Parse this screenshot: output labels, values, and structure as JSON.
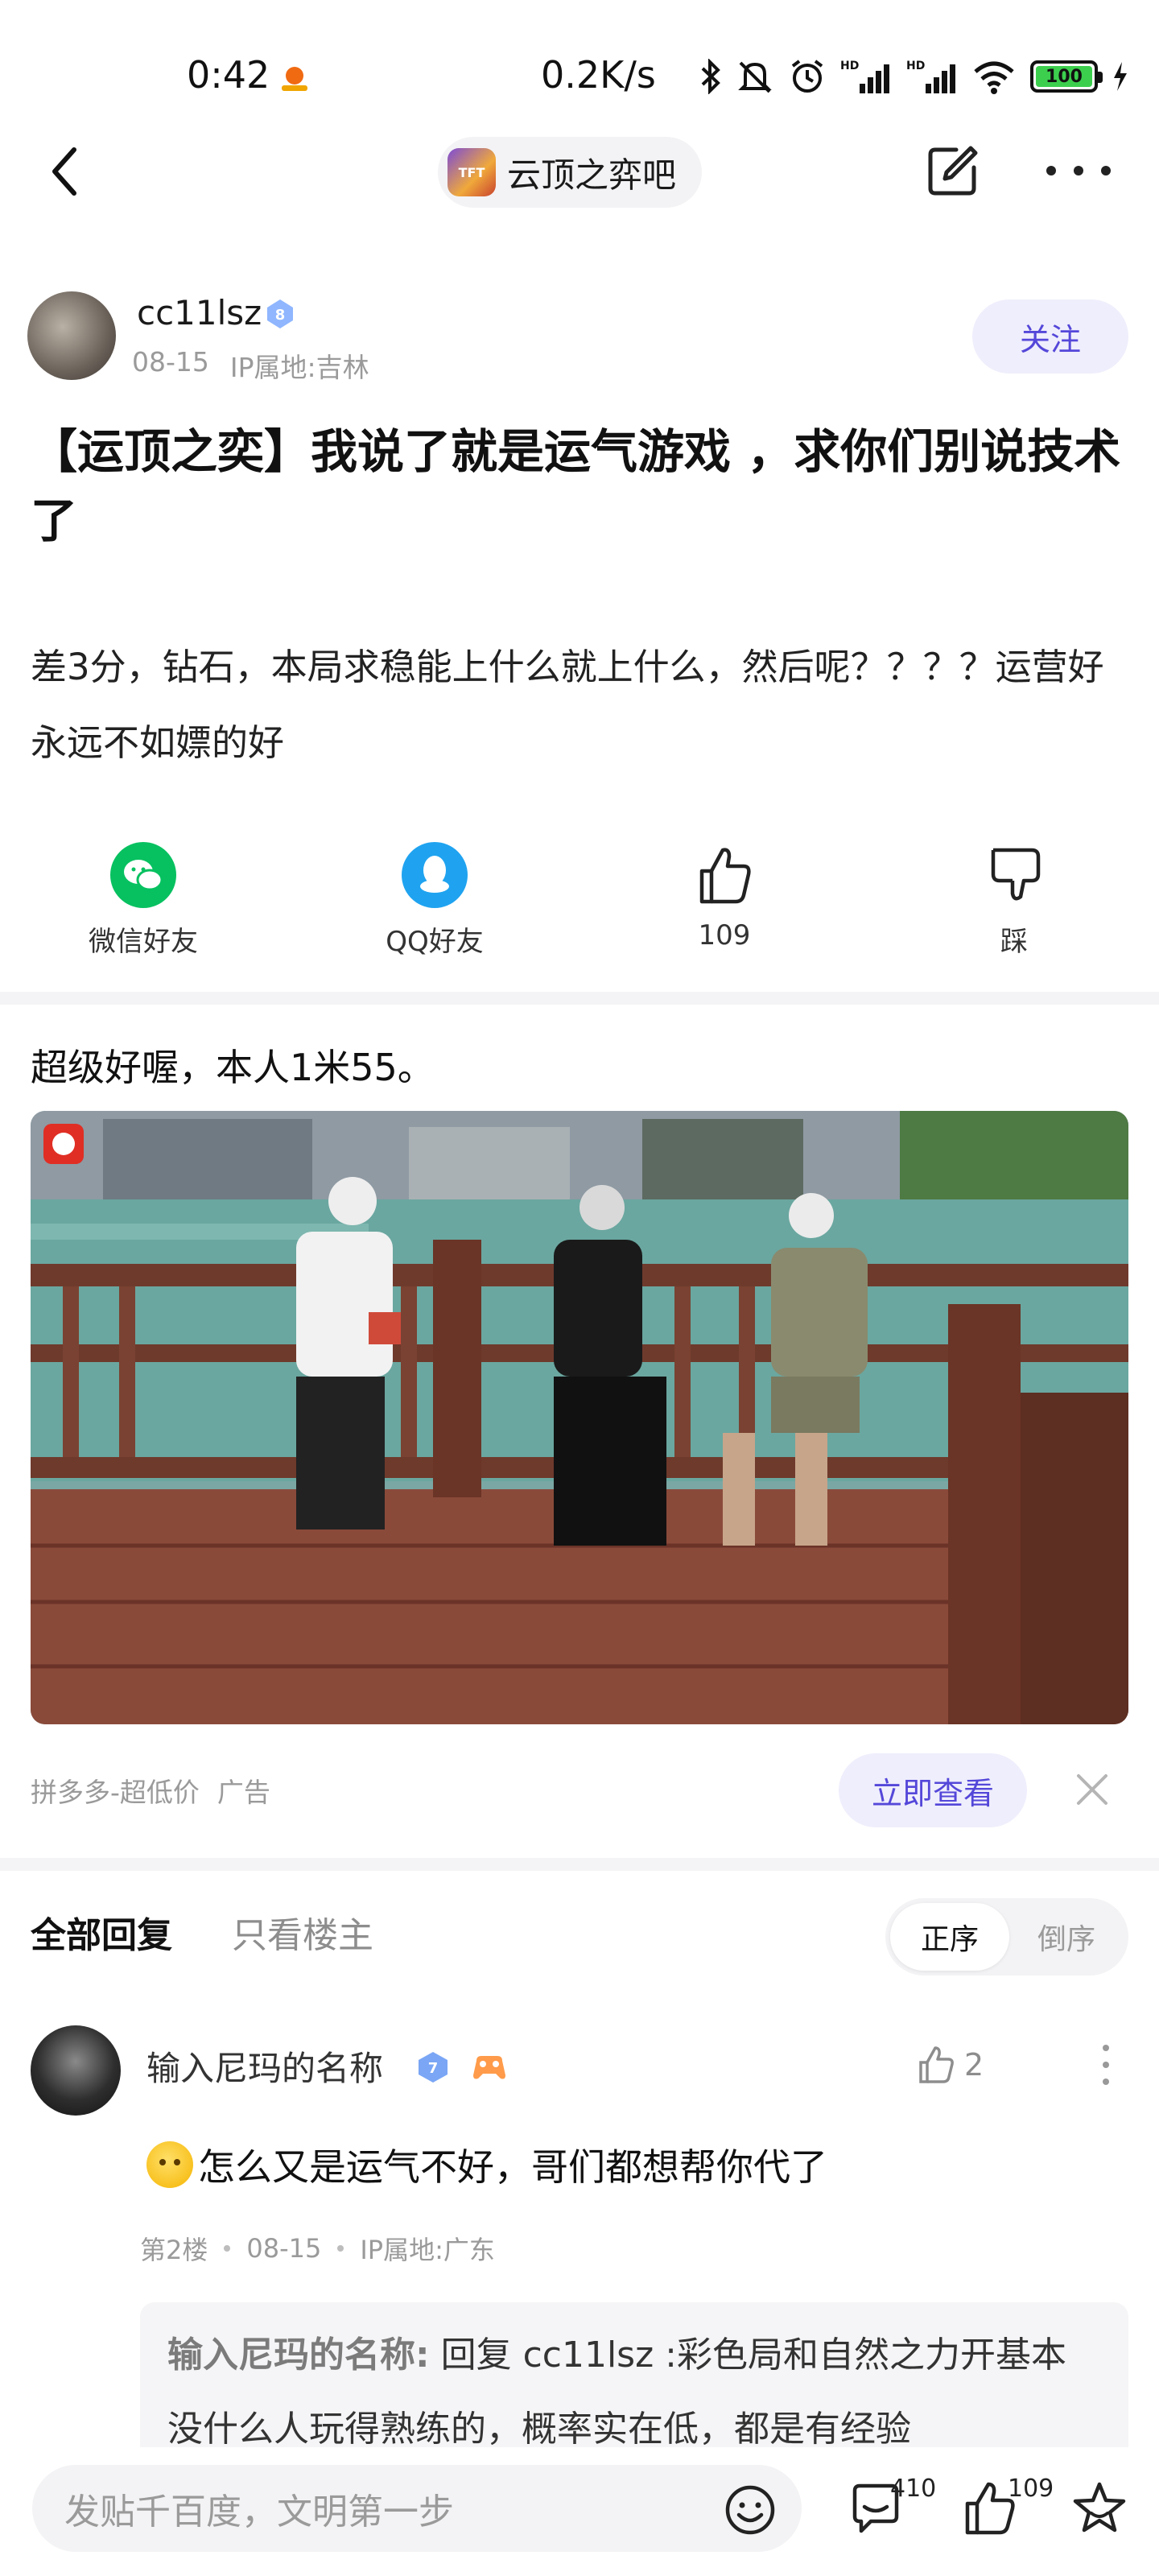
{
  "status_bar": {
    "time": "0:42",
    "network_speed": "0.2K/s",
    "battery": "100"
  },
  "nav": {
    "forum_name": "云顶之弈吧"
  },
  "author": {
    "name": "cc11lsz",
    "level": "8",
    "date": "08-15",
    "ip_location": "IP属地:吉林",
    "follow_label": "关注"
  },
  "post": {
    "title": "【运顶之奕】我说了就是运气游戏 ，求你们别说技术了",
    "body": "差3分，钻石，本局求稳能上什么就上什么，然后呢？？？？运营好永远不如嫖的好"
  },
  "share": {
    "wechat_label": "微信好友",
    "qq_label": "QQ好友",
    "like_count": "109",
    "dislike_label": "踩"
  },
  "ad": {
    "caption": "超级好喔，本人1米55。",
    "source": "拼多多-超低价",
    "tag": "广告",
    "cta_label": "立即查看"
  },
  "replies": {
    "tab_all": "全部回复",
    "tab_op": "只看楼主",
    "sort_asc": "正序",
    "sort_desc": "倒序",
    "items": [
      {
        "name": "输入尼玛的名称",
        "level": "7",
        "likes": "2",
        "text": "怎么又是运气不好，哥们都想帮你代了",
        "floor": "第2楼",
        "date": "08-15",
        "ip_location": "IP属地:广东",
        "quote_name": "输入尼玛的名称:",
        "quote_text": " 回复 cc11lsz :彩色局和自然之力开基本没什么人玩得熟练的，概率实在低，都是有经验"
      }
    ]
  },
  "bottom_bar": {
    "input_placeholder": "发贴千百度，文明第一步",
    "comment_count": "410",
    "like_count": "109"
  },
  "colors": {
    "accent": "#5447d9",
    "accent_bg": "#efeefc",
    "wechat_green": "#07c160",
    "qq_blue": "#1fa3f0"
  }
}
